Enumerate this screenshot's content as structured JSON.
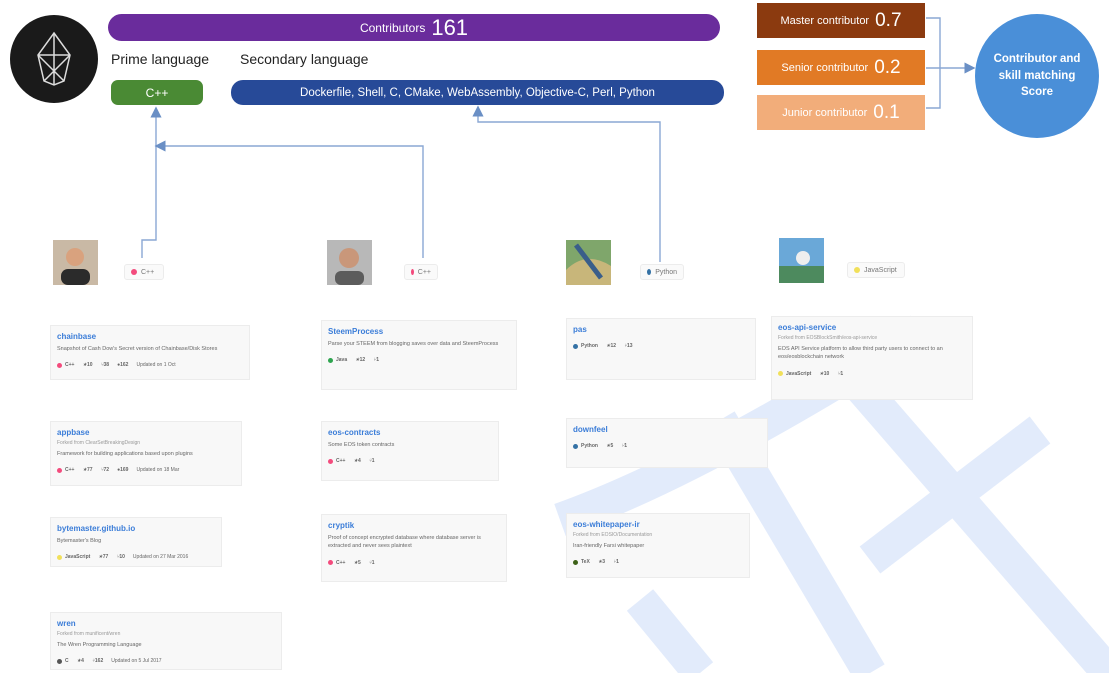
{
  "header": {
    "contributors_label": "Contributors",
    "contributors_count": "161",
    "prime_language_label": "Prime language",
    "secondary_language_label": "Secondary language",
    "prime_language": "C++",
    "secondary_languages": "Dockerfile, Shell, C, CMake, WebAssembly, Objective-C, Perl, Python"
  },
  "levels": [
    {
      "label": "Master contributor",
      "value": "0.7",
      "color": "#8b3a0f"
    },
    {
      "label": "Senior contributor",
      "value": "0.2",
      "color": "#e17a25"
    },
    {
      "label": "Junior contributor",
      "value": "0.1",
      "color": "#f2ad7a"
    }
  ],
  "score_label": "Contributor and skill matching Score",
  "contributors": [
    {
      "language": "C++",
      "language_color": "#f34b7d",
      "repos": [
        {
          "name": "chainbase",
          "forked_from": "",
          "description": "Snapshot of Cash Dow's Secret version of Chainbase/Disk Stores",
          "language": "C++",
          "language_color": "#f34b7d",
          "stars": "10",
          "forks": "38",
          "extra": "162",
          "updated": "Updated on 1 Oct"
        },
        {
          "name": "appbase",
          "forked_from": "Forked from ClearSetBreakingDesign",
          "description": "Framework for building applications based upon plugins",
          "language": "C++",
          "language_color": "#f34b7d",
          "stars": "77",
          "forks": "72",
          "extra": "169",
          "updated": "Updated on 18 Mar"
        },
        {
          "name": "bytemaster.github.io",
          "forked_from": "",
          "description": "Bytemaster's Blog",
          "language": "JavaScript",
          "language_color": "#f1e05a",
          "stars": "77",
          "forks": "10",
          "extra": "",
          "updated": "Updated on 27 Mar 2016"
        },
        {
          "name": "wren",
          "forked_from": "Forked from munificent/wren",
          "description": "The Wren Programming Language",
          "language": "C",
          "language_color": "#555555",
          "stars": "4",
          "forks": "162",
          "extra": "",
          "updated": "Updated on 5 Jul 2017"
        }
      ]
    },
    {
      "language": "C++",
      "language_color": "#f34b7d",
      "repos": [
        {
          "name": "SteemProcess",
          "forked_from": "",
          "description": "Parse your STEEM from blogging saves over data and SteemProcess",
          "language": "Java",
          "language_color": "#2ea44f",
          "stars": "12",
          "forks": "1",
          "extra": "",
          "updated": ""
        },
        {
          "name": "eos-contracts",
          "forked_from": "",
          "description": "Some EOS token contracts",
          "language": "C++",
          "language_color": "#f34b7d",
          "stars": "4",
          "forks": "1",
          "extra": "",
          "updated": ""
        },
        {
          "name": "cryptik",
          "forked_from": "",
          "description": "Proof of concept encrypted database where database server is extracted and never sees plaintext",
          "language": "C++",
          "language_color": "#f34b7d",
          "stars": "5",
          "forks": "1",
          "extra": "",
          "updated": ""
        }
      ]
    },
    {
      "language": "Python",
      "language_color": "#3572A5",
      "repos": [
        {
          "name": "pas",
          "forked_from": "",
          "description": "",
          "language": "Python",
          "language_color": "#3572A5",
          "stars": "12",
          "forks": "13",
          "extra": "",
          "updated": ""
        },
        {
          "name": "downfeel",
          "forked_from": "",
          "description": "",
          "language": "Python",
          "language_color": "#3572A5",
          "stars": "5",
          "forks": "1",
          "extra": "",
          "updated": ""
        },
        {
          "name": "eos-whitepaper-ir",
          "forked_from": "Forked from EOSIO/Documentation",
          "description": "Iran-friendly Farsi whitepaper",
          "language": "TeX",
          "language_color": "#3D6117",
          "stars": "3",
          "forks": "1",
          "extra": "",
          "updated": ""
        }
      ]
    },
    {
      "language": "JavaScript",
      "language_color": "#f1e05a",
      "repos": [
        {
          "name": "eos-api-service",
          "forked_from": "Forked from EOSBlockSmith/eos-api-service",
          "description": "EOS API Service platform to allow third party users to connect to an eos/eosblockchain network",
          "language": "JavaScript",
          "language_color": "#f1e05a",
          "stars": "10",
          "forks": "1",
          "extra": "",
          "updated": ""
        }
      ]
    }
  ]
}
